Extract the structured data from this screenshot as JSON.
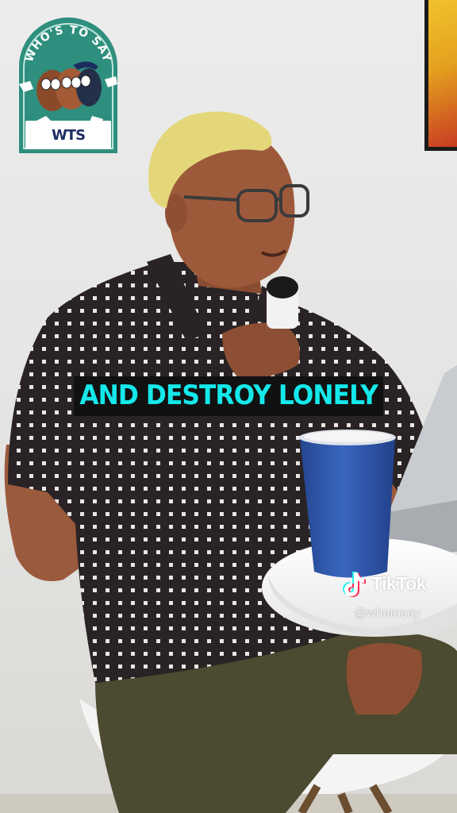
{
  "video": {
    "caption": "AND DESTROY LONELY",
    "caption_color": "#14e8ea"
  },
  "logo": {
    "arc_text": "WHO'S TO SAY",
    "badge_text": "WTS",
    "bg_color": "#2f8f7e"
  },
  "watermark": {
    "brand": "TikTok",
    "handle": "@whotosay",
    "icon": "tiktok-note-icon"
  },
  "colors": {
    "wall": "#ececec",
    "shirt": "#2a2325",
    "pants": "#4c4a30",
    "cup": "#2f58b0",
    "hair": "#e3d77a"
  }
}
